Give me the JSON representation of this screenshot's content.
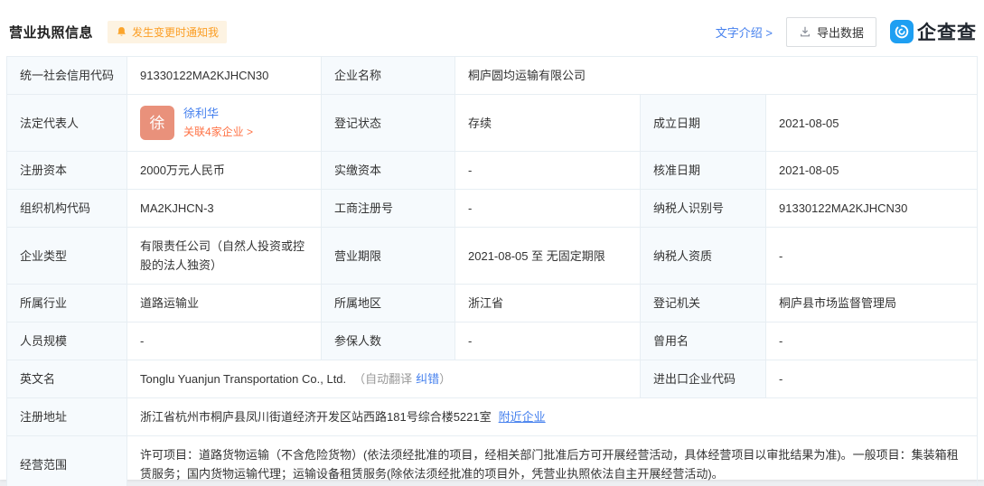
{
  "header": {
    "title": "营业执照信息",
    "notify_label": "发生变更时通知我",
    "text_intro": "文字介绍 >",
    "export_label": "导出数据",
    "brand": "企查查"
  },
  "colors": {
    "link_blue": "#4580EE",
    "related_orange": "#FF7245",
    "badge_orange": "#FB9E25",
    "badge_bg": "#FDF3E2",
    "avatar_bg": "#E9917B",
    "logo_blue": "#1E9FF2",
    "label_cell_bg": "#F6FAFD",
    "table_border": "#E7EEF3"
  },
  "fields": {
    "credit_code": {
      "label": "统一社会信用代码",
      "value": "91330122MA2KJHCN30"
    },
    "company_name": {
      "label": "企业名称",
      "value": "桐庐圆均运输有限公司"
    },
    "legal_rep": {
      "label": "法定代表人",
      "avatar_char": "徐",
      "name": "徐利华",
      "related_link": "关联4家企业 >"
    },
    "reg_status": {
      "label": "登记状态",
      "value": "存续"
    },
    "establish_date": {
      "label": "成立日期",
      "value": "2021-08-05"
    },
    "reg_capital": {
      "label": "注册资本",
      "value": "2000万元人民币"
    },
    "paid_capital": {
      "label": "实缴资本",
      "value": "-"
    },
    "approval_date": {
      "label": "核准日期",
      "value": "2021-08-05"
    },
    "org_code": {
      "label": "组织机构代码",
      "value": "MA2KJHCN-3"
    },
    "biz_reg_no": {
      "label": "工商注册号",
      "value": "-"
    },
    "taxpayer_id": {
      "label": "纳税人识别号",
      "value": "91330122MA2KJHCN30"
    },
    "company_type": {
      "label": "企业类型",
      "value": "有限责任公司（自然人投资或控股的法人独资）"
    },
    "biz_term": {
      "label": "营业期限",
      "value": "2021-08-05 至 无固定期限"
    },
    "taxpayer_qual": {
      "label": "纳税人资质",
      "value": "-"
    },
    "industry": {
      "label": "所属行业",
      "value": "道路运输业"
    },
    "region": {
      "label": "所属地区",
      "value": "浙江省"
    },
    "reg_authority": {
      "label": "登记机关",
      "value": "桐庐县市场监督管理局"
    },
    "staff_size": {
      "label": "人员规模",
      "value": "-"
    },
    "insured_count": {
      "label": "参保人数",
      "value": "-"
    },
    "former_name": {
      "label": "曾用名",
      "value": "-"
    },
    "english_name": {
      "label": "英文名",
      "value": "Tonglu Yuanjun Transportation Co., Ltd.",
      "note_prefix": "（自动翻译",
      "correction_link": "纠错",
      "note_suffix": "）"
    },
    "import_export_code": {
      "label": "进出口企业代码",
      "value": "-"
    },
    "reg_address": {
      "label": "注册地址",
      "value": "浙江省杭州市桐庐县凤川街道经济开发区站西路181号综合楼5221室",
      "nearby_link": "附近企业"
    },
    "biz_scope": {
      "label": "经营范围",
      "value": "许可项目：道路货物运输（不含危险货物）(依法须经批准的项目，经相关部门批准后方可开展经营活动，具体经营项目以审批结果为准)。一般项目：集装箱租赁服务；国内货物运输代理；运输设备租赁服务(除依法须经批准的项目外，凭营业执照依法自主开展经营活动)。"
    }
  }
}
